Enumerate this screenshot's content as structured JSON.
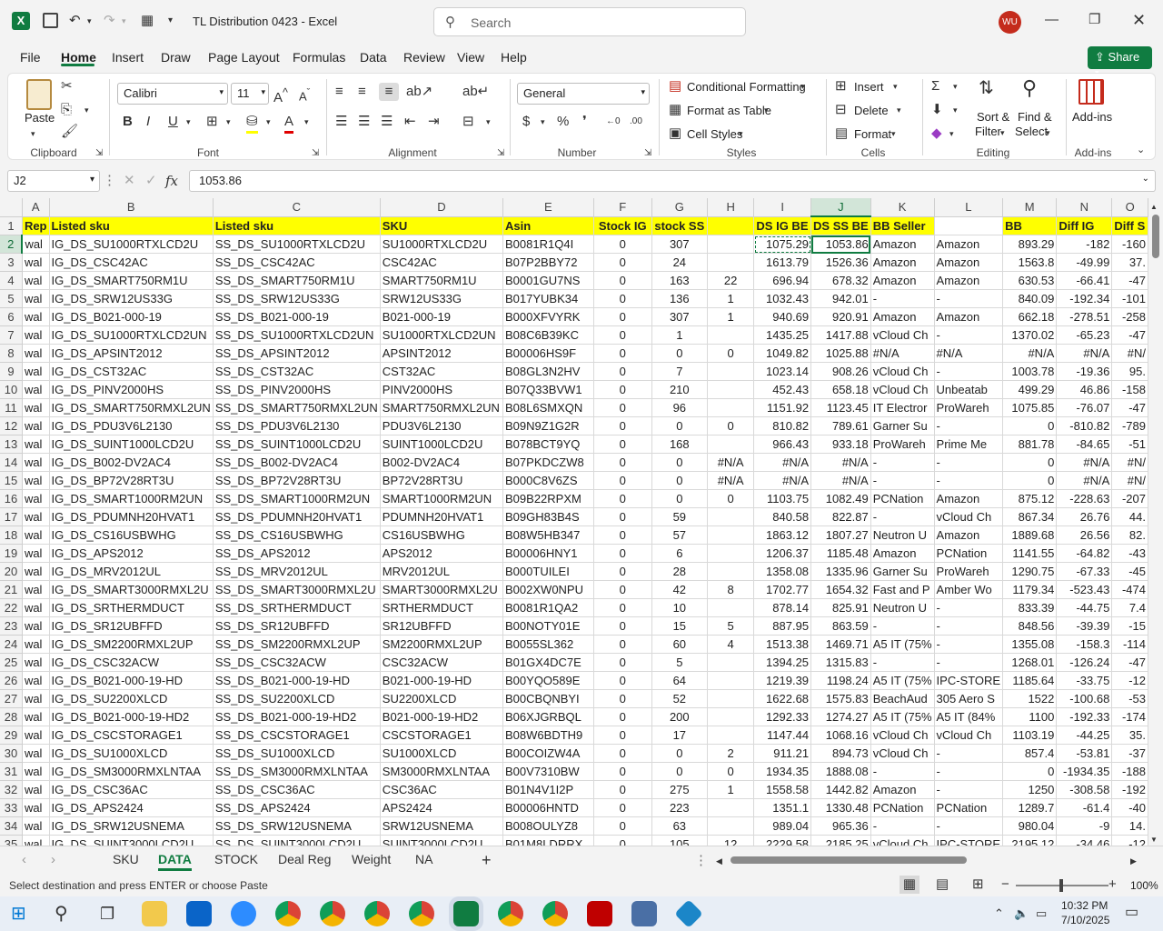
{
  "window": {
    "title": "TL Distribution 0423  -  Excel",
    "search_placeholder": "Search",
    "user_initials": "WU"
  },
  "menu": {
    "items": [
      "File",
      "Home",
      "Insert",
      "Draw",
      "Page Layout",
      "Formulas",
      "Data",
      "Review",
      "View",
      "Help"
    ],
    "share_label": "Share"
  },
  "ribbon": {
    "clipboard": {
      "paste": "Paste",
      "label": "Clipboard"
    },
    "font": {
      "name": "Calibri",
      "size": "11",
      "label": "Font"
    },
    "alignment": {
      "label": "Alignment"
    },
    "number": {
      "format": "General",
      "label": "Number"
    },
    "styles": {
      "conditional": "Conditional Formatting",
      "format_table": "Format as Table",
      "cell_styles": "Cell Styles",
      "label": "Styles"
    },
    "cells": {
      "insert": "Insert",
      "delete": "Delete",
      "format": "Format",
      "label": "Cells"
    },
    "editing": {
      "sort1": "Sort &",
      "sort2": "Filter",
      "find1": "Find &",
      "find2": "Select",
      "label": "Editing"
    },
    "addins": {
      "btn": "Add-ins",
      "label": "Add-ins"
    }
  },
  "formula_bar": {
    "name_box": "J2",
    "formula": "1053.86"
  },
  "columns": [
    "A",
    "B",
    "C",
    "D",
    "E",
    "F",
    "G",
    "H",
    "I",
    "J",
    "K",
    "L",
    "M",
    "N",
    "O"
  ],
  "header_row": [
    "Rep",
    "Listed sku",
    "Listed sku",
    "SKU",
    "Asin",
    "Stock IG",
    "stock SS",
    "",
    "DS IG BE",
    "DS SS BE",
    "BB Seller",
    "",
    "BB",
    "Diff IG",
    "Diff S"
  ],
  "rows": [
    [
      "wal",
      "IG_DS_SU1000RTXLCD2U",
      "SS_DS_SU1000RTXLCD2U",
      "SU1000RTXLCD2U",
      "B0081R1Q4I",
      "0",
      "307",
      "",
      "1075.29",
      "1053.86",
      "Amazon",
      "Amazon",
      "893.29",
      "-182",
      "-160"
    ],
    [
      "wal",
      "IG_DS_CSC42AC",
      "SS_DS_CSC42AC",
      "CSC42AC",
      "B07P2BBY72",
      "0",
      "24",
      "",
      "1613.79",
      "1526.36",
      "Amazon",
      "Amazon",
      "1563.8",
      "-49.99",
      "37."
    ],
    [
      "wal",
      "IG_DS_SMART750RM1U",
      "SS_DS_SMART750RM1U",
      "SMART750RM1U",
      "B0001GU7NS",
      "0",
      "163",
      "22",
      "696.94",
      "678.32",
      "Amazon",
      "Amazon",
      "630.53",
      "-66.41",
      "-47"
    ],
    [
      "wal",
      "IG_DS_SRW12US33G",
      "SS_DS_SRW12US33G",
      "SRW12US33G",
      "B017YUBK34",
      "0",
      "136",
      "1",
      "1032.43",
      "942.01",
      "-",
      "-",
      "840.09",
      "-192.34",
      "-101"
    ],
    [
      "wal",
      "IG_DS_B021-000-19",
      "SS_DS_B021-000-19",
      "B021-000-19",
      "B000XFVYRK",
      "0",
      "307",
      "1",
      "940.69",
      "920.91",
      "Amazon",
      "Amazon",
      "662.18",
      "-278.51",
      "-258"
    ],
    [
      "wal",
      "IG_DS_SU1000RTXLCD2UN",
      "SS_DS_SU1000RTXLCD2UN",
      "SU1000RTXLCD2UN",
      "B08C6B39KC",
      "0",
      "1",
      "",
      "1435.25",
      "1417.88",
      "vCloud Ch",
      "-",
      "1370.02",
      "-65.23",
      "-47"
    ],
    [
      "wal",
      "IG_DS_APSINT2012",
      "SS_DS_APSINT2012",
      "APSINT2012",
      "B00006HS9F",
      "0",
      "0",
      "0",
      "1049.82",
      "1025.88",
      "#N/A",
      "#N/A",
      "#N/A",
      "#N/A",
      "#N/"
    ],
    [
      "wal",
      "IG_DS_CST32AC",
      "SS_DS_CST32AC",
      "CST32AC",
      "B08GL3N2HV",
      "0",
      "7",
      "",
      "1023.14",
      "908.26",
      "vCloud Ch",
      "-",
      "1003.78",
      "-19.36",
      "95."
    ],
    [
      "wal",
      "IG_DS_PINV2000HS",
      "SS_DS_PINV2000HS",
      "PINV2000HS",
      "B07Q33BVW1",
      "0",
      "210",
      "",
      "452.43",
      "658.18",
      "vCloud Ch",
      "Unbeatab",
      "499.29",
      "46.86",
      "-158"
    ],
    [
      "wal",
      "IG_DS_SMART750RMXL2UN",
      "SS_DS_SMART750RMXL2UN",
      "SMART750RMXL2UN",
      "B08L6SMXQN",
      "0",
      "96",
      "",
      "1151.92",
      "1123.45",
      "IT Electror",
      "ProWareh",
      "1075.85",
      "-76.07",
      "-47"
    ],
    [
      "wal",
      "IG_DS_PDU3V6L2130",
      "SS_DS_PDU3V6L2130",
      "PDU3V6L2130",
      "B09N9Z1G2R",
      "0",
      "0",
      "0",
      "810.82",
      "789.61",
      "Garner Su",
      "-",
      "0",
      "-810.82",
      "-789"
    ],
    [
      "wal",
      "IG_DS_SUINT1000LCD2U",
      "SS_DS_SUINT1000LCD2U",
      "SUINT1000LCD2U",
      "B078BCT9YQ",
      "0",
      "168",
      "",
      "966.43",
      "933.18",
      "ProWareh",
      "Prime Me",
      "881.78",
      "-84.65",
      "-51"
    ],
    [
      "wal",
      "IG_DS_B002-DV2AC4",
      "SS_DS_B002-DV2AC4",
      "B002-DV2AC4",
      "B07PKDCZW8",
      "0",
      "0",
      "#N/A",
      "#N/A",
      "#N/A",
      "-",
      "-",
      "0",
      "#N/A",
      "#N/"
    ],
    [
      "wal",
      "IG_DS_BP72V28RT3U",
      "SS_DS_BP72V28RT3U",
      "BP72V28RT3U",
      "B000C8V6ZS",
      "0",
      "0",
      "#N/A",
      "#N/A",
      "#N/A",
      "-",
      "-",
      "0",
      "#N/A",
      "#N/"
    ],
    [
      "wal",
      "IG_DS_SMART1000RM2UN",
      "SS_DS_SMART1000RM2UN",
      "SMART1000RM2UN",
      "B09B22RPXM",
      "0",
      "0",
      "0",
      "1103.75",
      "1082.49",
      "PCNation",
      "Amazon",
      "875.12",
      "-228.63",
      "-207"
    ],
    [
      "wal",
      "IG_DS_PDUMNH20HVAT1",
      "SS_DS_PDUMNH20HVAT1",
      "PDUMNH20HVAT1",
      "B09GH83B4S",
      "0",
      "59",
      "",
      "840.58",
      "822.87",
      "-",
      "vCloud Ch",
      "867.34",
      "26.76",
      "44."
    ],
    [
      "wal",
      "IG_DS_CS16USBWHG",
      "SS_DS_CS16USBWHG",
      "CS16USBWHG",
      "B08W5HB347",
      "0",
      "57",
      "",
      "1863.12",
      "1807.27",
      "Neutron U",
      "Amazon",
      "1889.68",
      "26.56",
      "82."
    ],
    [
      "wal",
      "IG_DS_APS2012",
      "SS_DS_APS2012",
      "APS2012",
      "B00006HNY1",
      "0",
      "6",
      "",
      "1206.37",
      "1185.48",
      "Amazon",
      "PCNation",
      "1141.55",
      "-64.82",
      "-43"
    ],
    [
      "wal",
      "IG_DS_MRV2012UL",
      "SS_DS_MRV2012UL",
      "MRV2012UL",
      "B000TUILEI",
      "0",
      "28",
      "",
      "1358.08",
      "1335.96",
      "Garner Su",
      "ProWareh",
      "1290.75",
      "-67.33",
      "-45"
    ],
    [
      "wal",
      "IG_DS_SMART3000RMXL2U",
      "SS_DS_SMART3000RMXL2U",
      "SMART3000RMXL2U",
      "B002XW0NPU",
      "0",
      "42",
      "8",
      "1702.77",
      "1654.32",
      "Fast and P",
      "Amber Wo",
      "1179.34",
      "-523.43",
      "-474"
    ],
    [
      "wal",
      "IG_DS_SRTHERMDUCT",
      "SS_DS_SRTHERMDUCT",
      "SRTHERMDUCT",
      "B0081R1QA2",
      "0",
      "10",
      "",
      "878.14",
      "825.91",
      "Neutron U",
      "-",
      "833.39",
      "-44.75",
      "7.4"
    ],
    [
      "wal",
      "IG_DS_SR12UBFFD",
      "SS_DS_SR12UBFFD",
      "SR12UBFFD",
      "B00NOTY01E",
      "0",
      "15",
      "5",
      "887.95",
      "863.59",
      "-",
      "-",
      "848.56",
      "-39.39",
      "-15"
    ],
    [
      "wal",
      "IG_DS_SM2200RMXL2UP",
      "SS_DS_SM2200RMXL2UP",
      "SM2200RMXL2UP",
      "B0055SL362",
      "0",
      "60",
      "4",
      "1513.38",
      "1469.71",
      "A5 IT (75%",
      "-",
      "1355.08",
      "-158.3",
      "-114"
    ],
    [
      "wal",
      "IG_DS_CSC32ACW",
      "SS_DS_CSC32ACW",
      "CSC32ACW",
      "B01GX4DC7E",
      "0",
      "5",
      "",
      "1394.25",
      "1315.83",
      "-",
      "-",
      "1268.01",
      "-126.24",
      "-47"
    ],
    [
      "wal",
      "IG_DS_B021-000-19-HD",
      "SS_DS_B021-000-19-HD",
      "B021-000-19-HD",
      "B00YQO589E",
      "0",
      "64",
      "",
      "1219.39",
      "1198.24",
      "A5 IT (75%",
      "IPC-STORE",
      "1185.64",
      "-33.75",
      "-12"
    ],
    [
      "wal",
      "IG_DS_SU2200XLCD",
      "SS_DS_SU2200XLCD",
      "SU2200XLCD",
      "B00CBQNBYI",
      "0",
      "52",
      "",
      "1622.68",
      "1575.83",
      "BeachAud",
      "305 Aero S",
      "1522",
      "-100.68",
      "-53"
    ],
    [
      "wal",
      "IG_DS_B021-000-19-HD2",
      "SS_DS_B021-000-19-HD2",
      "B021-000-19-HD2",
      "B06XJGRBQL",
      "0",
      "200",
      "",
      "1292.33",
      "1274.27",
      "A5 IT (75%",
      "A5 IT (84%",
      "1100",
      "-192.33",
      "-174"
    ],
    [
      "wal",
      "IG_DS_CSCSTORAGE1",
      "SS_DS_CSCSTORAGE1",
      "CSCSTORAGE1",
      "B08W6BDTH9",
      "0",
      "17",
      "",
      "1147.44",
      "1068.16",
      "vCloud Ch",
      "vCloud Ch",
      "1103.19",
      "-44.25",
      "35."
    ],
    [
      "wal",
      "IG_DS_SU1000XLCD",
      "SS_DS_SU1000XLCD",
      "SU1000XLCD",
      "B00COIZW4A",
      "0",
      "0",
      "2",
      "911.21",
      "894.73",
      "vCloud Ch",
      "-",
      "857.4",
      "-53.81",
      "-37"
    ],
    [
      "wal",
      "IG_DS_SM3000RMXLNTAA",
      "SS_DS_SM3000RMXLNTAA",
      "SM3000RMXLNTAA",
      "B00V7310BW",
      "0",
      "0",
      "0",
      "1934.35",
      "1888.08",
      "-",
      "-",
      "0",
      "-1934.35",
      "-188"
    ],
    [
      "wal",
      "IG_DS_CSC36AC",
      "SS_DS_CSC36AC",
      "CSC36AC",
      "B01N4V1I2P",
      "0",
      "275",
      "1",
      "1558.58",
      "1442.82",
      "Amazon",
      "-",
      "1250",
      "-308.58",
      "-192"
    ],
    [
      "wal",
      "IG_DS_APS2424",
      "SS_DS_APS2424",
      "APS2424",
      "B00006HNTD",
      "0",
      "223",
      "",
      "1351.1",
      "1330.48",
      "PCNation",
      "PCNation",
      "1289.7",
      "-61.4",
      "-40"
    ],
    [
      "wal",
      "IG_DS_SRW12USNEMA",
      "SS_DS_SRW12USNEMA",
      "SRW12USNEMA",
      "B008OULYZ8",
      "0",
      "63",
      "",
      "989.04",
      "965.36",
      "-",
      "-",
      "980.04",
      "-9",
      "14."
    ],
    [
      "wal",
      "IG_DS_SUINT3000LCD2U",
      "SS_DS_SUINT3000LCD2U",
      "SUINT3000LCD2U",
      "B01M8LDRRX",
      "0",
      "105",
      "12",
      "2229.58",
      "2185.25",
      "vCloud Ch",
      "IPC-STORE",
      "2195.12",
      "-34.46",
      "-12"
    ]
  ],
  "sheet_tabs": [
    "SKU",
    "DATA",
    "STOCK",
    "Deal Reg",
    "Weight",
    "NA"
  ],
  "active_tab": "DATA",
  "status": {
    "message": "Select destination and press ENTER or choose Paste",
    "zoom": "100%"
  },
  "taskbar": {
    "time": "10:32 PM",
    "date": "7/10/2025"
  }
}
